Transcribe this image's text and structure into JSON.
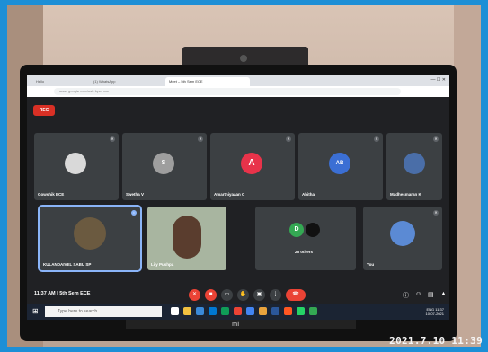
{
  "browser": {
    "tabs": [
      {
        "label": "Hello"
      },
      {
        "label": "(1) WhatsApp"
      },
      {
        "label": "Meet – 5th Sem ECE"
      }
    ],
    "url": "meet.google.com/aah-fqzu-uos"
  },
  "meet": {
    "rec_label": "REC",
    "participants_row1": [
      {
        "name": "Gowshik ECE",
        "initial": "",
        "avatar_color": "#8a8a8a"
      },
      {
        "name": "Swetha V",
        "initial": "S",
        "avatar_color": "#9e9e9e"
      },
      {
        "name": "Amarthiyaaan C",
        "initial": "A",
        "avatar_color": "#e8334a"
      },
      {
        "name": "Abitha",
        "initial": "AB",
        "avatar_color": "#3b6fd4"
      },
      {
        "name": "Madhesmaran K",
        "initial": "",
        "avatar_color": "#4a6ea8"
      }
    ],
    "participants_row2": [
      {
        "name": "KULANDAIVEL SABU SP",
        "avatar_color": "#6b5a40"
      },
      {
        "name": "Lily Pushpa",
        "avatar_color": "#a8b5a0"
      },
      {
        "name": "25 others",
        "avatar_color": "#3c4043"
      },
      {
        "name": "You",
        "avatar_color": "#5b8ad4"
      }
    ],
    "others_initial": "D",
    "meeting_info": "11:37 AM | 5th Sem ECE"
  },
  "taskbar": {
    "search_placeholder": "Type here to search",
    "time": "11:37",
    "date": "10-07-2021",
    "lang": "ENG"
  },
  "laptop_brand": "mi",
  "photo_timestamp": "2021.7.10 11:39",
  "colors": {
    "meet_bg": "#202124",
    "tile_bg": "#3c4043",
    "accent_red": "#ea4335",
    "speaking_outline": "#8ab4f8"
  }
}
